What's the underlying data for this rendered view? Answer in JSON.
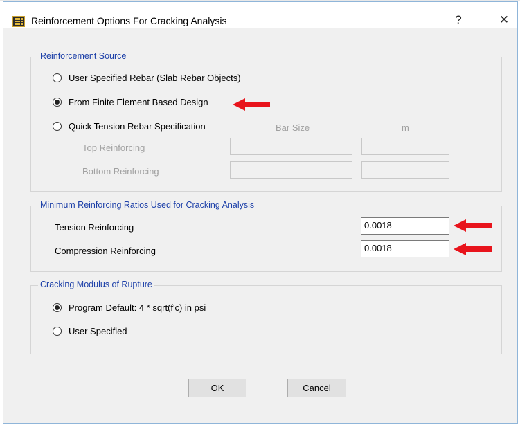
{
  "dialog": {
    "title": "Reinforcement Options For Cracking Analysis",
    "help_label": "?",
    "close_label": "✕"
  },
  "reinforcement_source": {
    "title": "Reinforcement Source",
    "options": [
      {
        "label": "User Specified Rebar  (Slab Rebar Objects)",
        "selected": false
      },
      {
        "label": "From Finite Element Based Design",
        "selected": true
      },
      {
        "label": "Quick Tension Rebar Specification",
        "selected": false
      }
    ],
    "col_bar_size": "Bar Size",
    "col_spacing": "m",
    "top_label": "Top Reinforcing",
    "bottom_label": "Bottom Reinforcing"
  },
  "min_ratios": {
    "title": "Minimum Reinforcing Ratios Used for Cracking Analysis",
    "tension_label": "Tension Reinforcing",
    "tension_value": "0.0018",
    "compression_label": "Compression Reinforcing",
    "compression_value": "0.0018"
  },
  "modulus_of_rupture": {
    "title": "Cracking Modulus of Rupture",
    "options": [
      {
        "label": "Program Default:  4 * sqrt(f'c) in psi",
        "selected": true
      },
      {
        "label": "User Specified",
        "selected": false
      }
    ]
  },
  "buttons": {
    "ok": "OK",
    "cancel": "Cancel"
  },
  "annotation_color": "#e8141c"
}
